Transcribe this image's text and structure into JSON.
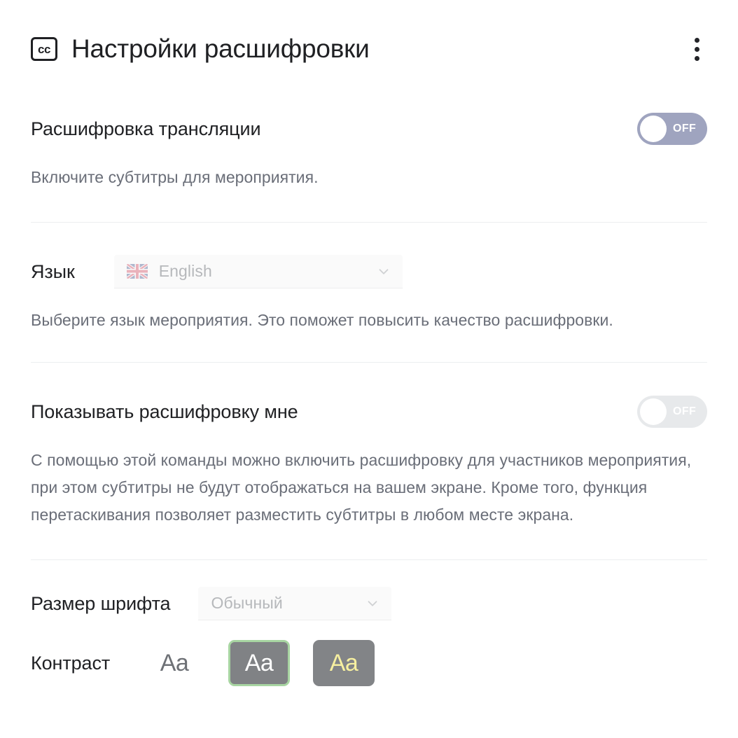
{
  "header": {
    "title": "Настройки расшифровки",
    "icon_label": "cc",
    "menu_icon": "kebab-menu-icon"
  },
  "broadcast_transcription": {
    "title": "Расшифровка трансляции",
    "toggle_state": "OFF",
    "description": "Включите субтитры для мероприятия."
  },
  "language": {
    "label": "Язык",
    "selected": "English",
    "flag_icon": "uk-flag-icon",
    "chevron_icon": "chevron-down-icon",
    "description": "Выберите язык мероприятия. Это поможет повысить качество расшифровки."
  },
  "show_transcription": {
    "title": "Показывать расшифровку мне",
    "toggle_state": "OFF",
    "description": "С помощью этой команды можно включить расшифровку для участников мероприятия, при этом субтитры не будут отображаться на вашем экране. Кроме того, функция перетаскивания позволяет разместить субтитры в любом месте экрана."
  },
  "font_size": {
    "label": "Размер шрифта",
    "selected": "Обычный",
    "chevron_icon": "chevron-down-icon"
  },
  "contrast": {
    "label": "Контраст",
    "options": [
      {
        "sample": "Aa",
        "name": "light",
        "selected": false
      },
      {
        "sample": "Aa",
        "name": "dark",
        "selected": true
      },
      {
        "sample": "Aa",
        "name": "yellow",
        "selected": false
      }
    ]
  },
  "colors": {
    "accent_toggle": "#9fa4bf",
    "muted_toggle": "#e7e9eb",
    "selection_border": "#a8d5a2",
    "text_primary": "#202124",
    "text_secondary": "#6a6e78",
    "swatch_dark_bg": "#808285",
    "swatch_yellow_text": "#f7f0a0"
  }
}
